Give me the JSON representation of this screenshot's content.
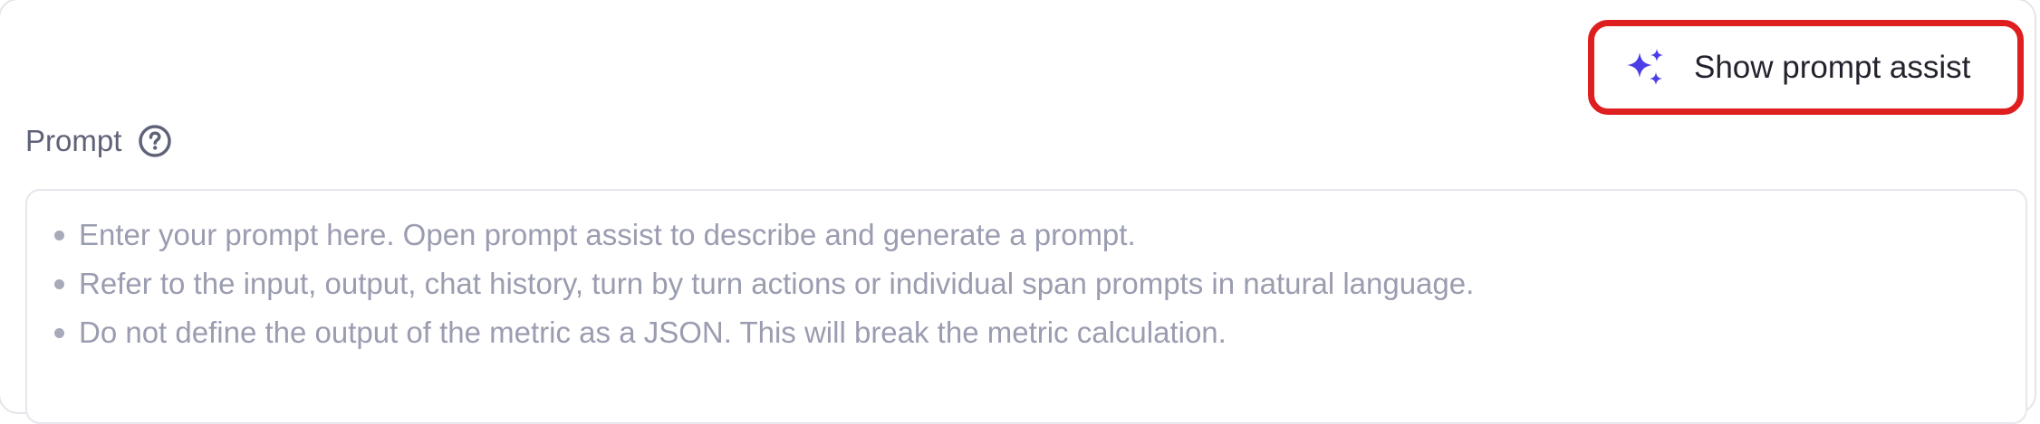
{
  "assist_button": {
    "label": "Show prompt assist",
    "icon": "sparkles-icon",
    "icon_color": "#4b3ee6",
    "highlight_color": "#df1f1f"
  },
  "prompt": {
    "label": "Prompt",
    "help_icon": "question-circle-icon",
    "placeholder_lines": [
      "Enter your prompt here. Open prompt assist to describe and generate a prompt.",
      "Refer to the input, output, chat history, turn by turn actions or individual span prompts in natural language.",
      "Do not define the output of the metric as a JSON. This will break the metric calculation."
    ]
  }
}
